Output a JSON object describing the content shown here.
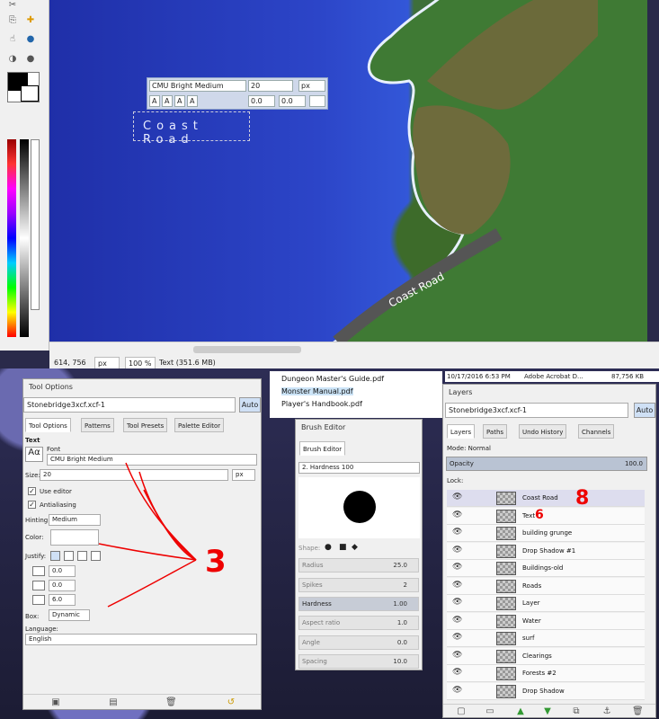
{
  "canvas": {
    "map_text": "Coast Road",
    "text_box_text": "Coast Road"
  },
  "text_toolbar": {
    "font": "CMU Bright Medium",
    "size": "20",
    "unit": "px",
    "baseline": "0.0",
    "kerning": "0.0"
  },
  "statusbar": {
    "coords": "614, 756",
    "unit": "px",
    "zoom": "100 %",
    "info": "Text (351.6 MB)"
  },
  "tool_options": {
    "title": "Tool Options",
    "image": "Stonebridge3xcf.xcf-1",
    "auto": "Auto",
    "tabs": [
      "Tool Options",
      "Patterns",
      "Tool Presets",
      "Palette Editor"
    ],
    "section": "Text",
    "font_label": "Font",
    "font_value": "CMU Bright Medium",
    "size_label": "Size:",
    "size_value": "20",
    "size_unit": "px",
    "use_editor": "Use editor",
    "antialiasing": "Antialiasing",
    "hinting_label": "Hinting:",
    "hinting_value": "Medium",
    "color_label": "Color:",
    "justify_label": "Justify:",
    "indent": "0.0",
    "line_spacing": "0.0",
    "letter_spacing": "6.0",
    "box_label": "Box:",
    "box_value": "Dynamic",
    "language_label": "Language:",
    "language_value": "English"
  },
  "files": {
    "items": [
      "Dungeon Master's Guide.pdf",
      "Monster Manual.pdf",
      "Player's Handbook.pdf"
    ],
    "date": "10/17/2016 6:53 PM",
    "type": "Adobe Acrobat D...",
    "size": "87,756 KB"
  },
  "brush_editor": {
    "title": "Brush Editor",
    "tab": "Brush Editor",
    "brush_name": "2. Hardness 100",
    "shape_label": "Shape:",
    "params": [
      {
        "label": "Radius",
        "value": "25.0"
      },
      {
        "label": "Spikes",
        "value": "2"
      },
      {
        "label": "Hardness",
        "value": "1.00"
      },
      {
        "label": "Aspect ratio",
        "value": "1.0"
      },
      {
        "label": "Angle",
        "value": "0.0"
      },
      {
        "label": "Spacing",
        "value": "10.0"
      }
    ]
  },
  "layers": {
    "title": "Layers",
    "image": "Stonebridge3xcf.xcf-1",
    "auto": "Auto",
    "tabs": [
      "Layers",
      "Paths",
      "Undo History",
      "Channels"
    ],
    "mode": "Mode: Normal",
    "opacity_label": "Opacity",
    "opacity_value": "100.0",
    "lock": "Lock:",
    "items": [
      "Coast Road",
      "Text",
      "building grunge",
      "Drop Shadow #1",
      "Buildings-old",
      "Roads",
      "Layer",
      "Water",
      "surf",
      "Clearings",
      "Forests #2",
      "Drop Shadow"
    ]
  },
  "annotations": {
    "three": "3",
    "six": "6",
    "eight": "8"
  }
}
